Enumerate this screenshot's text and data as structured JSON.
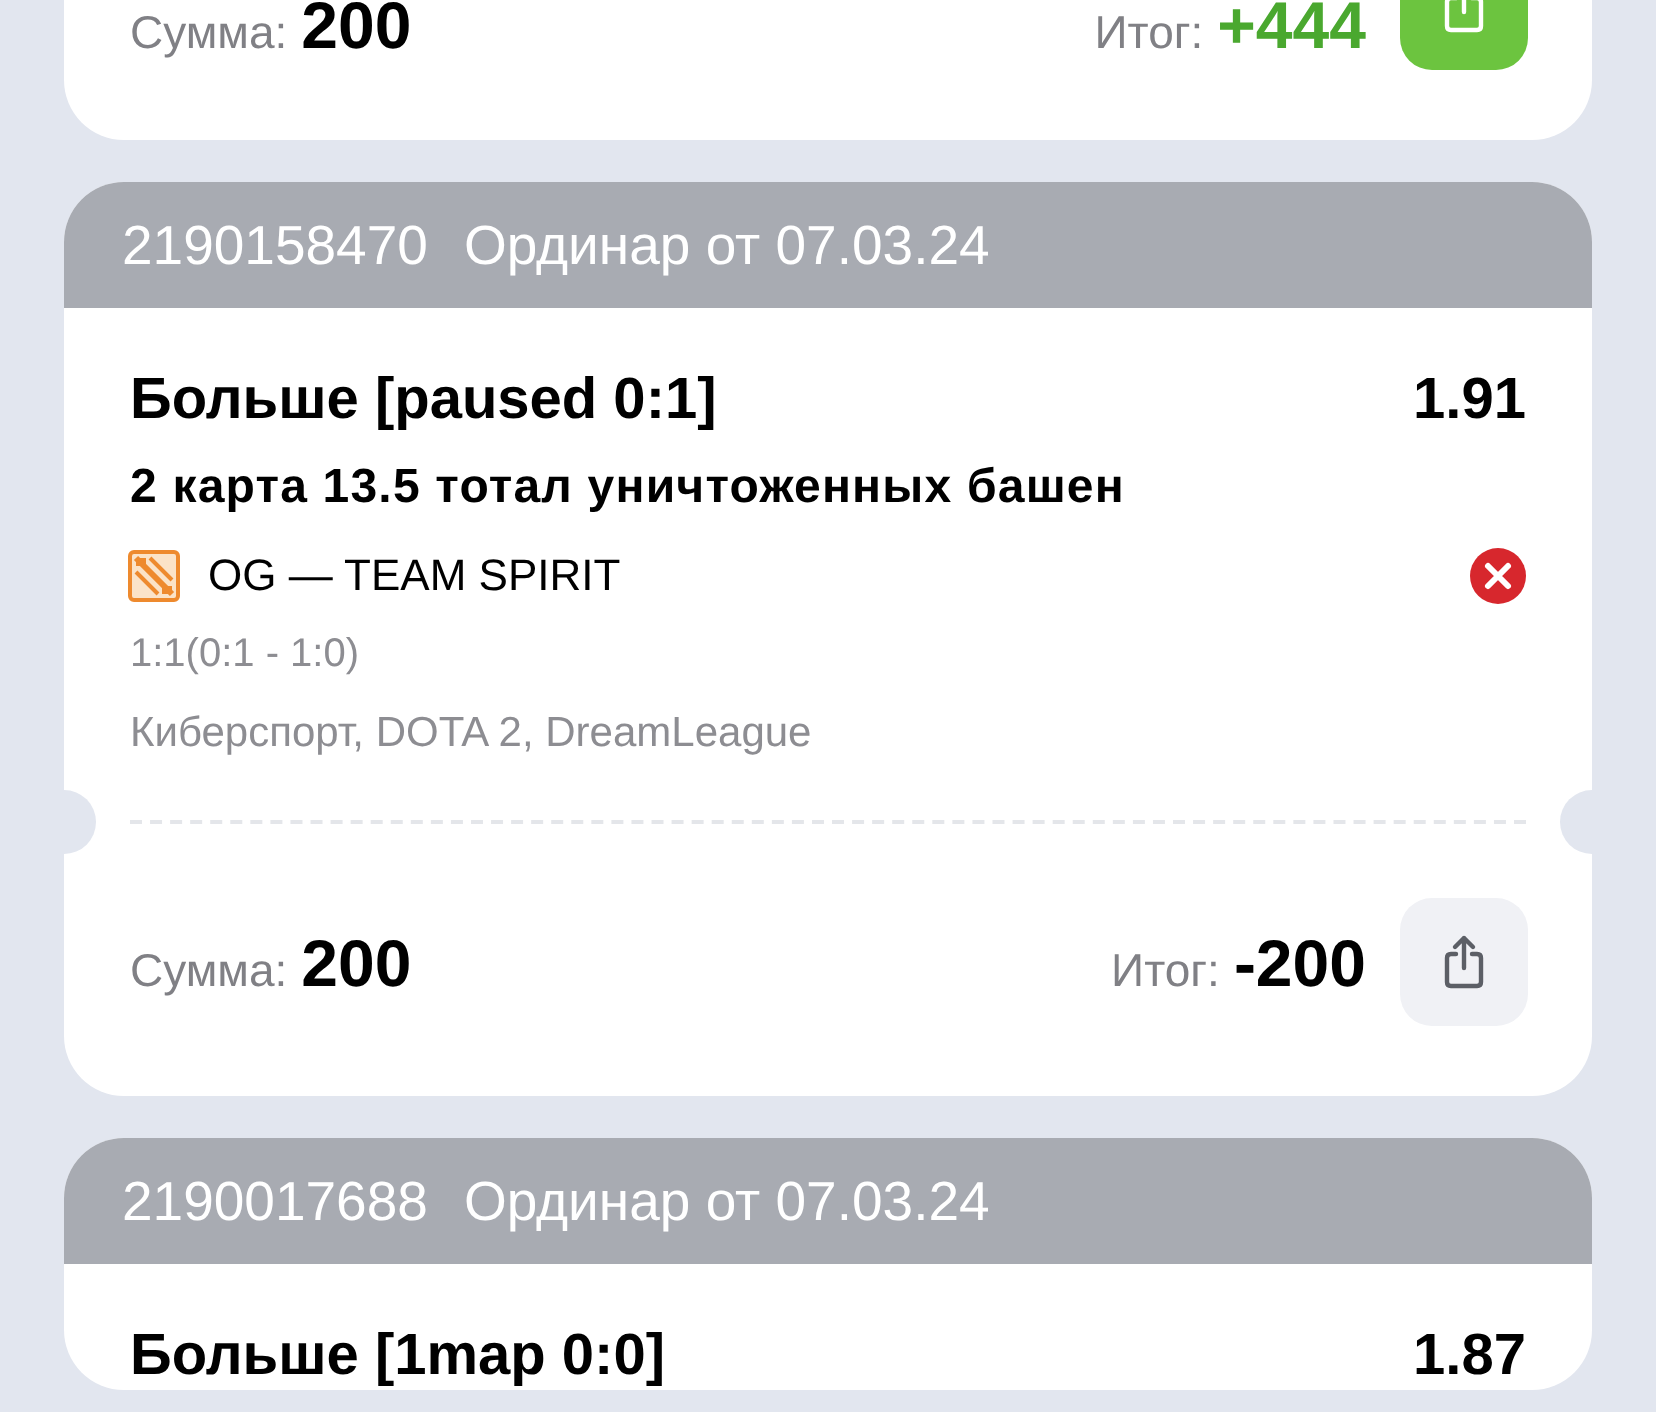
{
  "bets": [
    {
      "won": true,
      "footer": {
        "sum_label": "Сумма:",
        "sum": "200",
        "total_label": "Итог:",
        "total": "+444"
      }
    },
    {
      "number": "2190158470",
      "title": "Ординар от 07.03.24",
      "won": false,
      "selection": "Больше [paused 0:1]",
      "odds": "1.91",
      "market": "2 карта 13.5 тотал уничтоженных башен",
      "event": "OG — TEAM SPIRIT",
      "score": "1:1(0:1 - 1:0)",
      "category": "Киберспорт, DOTA 2, DreamLeague",
      "footer": {
        "sum_label": "Сумма:",
        "sum": "200",
        "total_label": "Итог:",
        "total": "-200"
      }
    },
    {
      "number": "2190017688",
      "title": "Ординар от 07.03.24",
      "selection": "Больше [1map 0:0]",
      "odds": "1.87"
    }
  ]
}
